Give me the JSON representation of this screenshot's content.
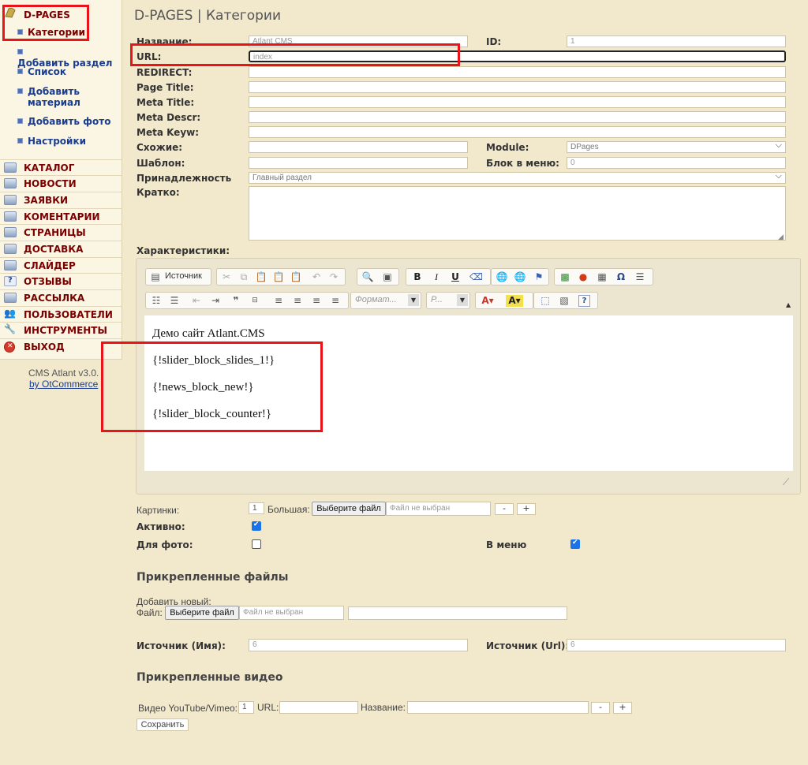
{
  "sidebar": {
    "header": "D-PAGES",
    "sub_items": [
      "Категории",
      "Добавить раздел",
      "Список",
      "Добавить материал",
      "Добавить фото",
      "Настройки"
    ],
    "main_items": [
      "КАТАЛОГ",
      "НОВОСТИ",
      "ЗАЯВКИ",
      "КОМЕНТАРИИ",
      "СТРАНИЦЫ",
      "ДОСТАВКА",
      "СЛАЙДЕР",
      "ОТЗЫВЫ",
      "РАССЫЛКА",
      "ПОЛЬЗОВАТЕЛИ",
      "ИНСТРУМЕНТЫ",
      "ВЫХОД"
    ],
    "footer_version": "CMS Atlant v3.0.",
    "footer_link": "by OtCommerce"
  },
  "page_title": "D-PAGES | Категории",
  "form": {
    "name_label": "Название:",
    "name_value": "Atlant CMS",
    "id_label": "ID:",
    "id_value": "1",
    "url_label": "URL:",
    "url_value": "index",
    "redirect_label": "REDIRECT:",
    "page_title_label": "Page Title:",
    "meta_title_label": "Meta Title:",
    "meta_descr_label": "Meta Descr:",
    "meta_keyw_label": "Meta Keyw:",
    "similar_label": "Схожие:",
    "module_label": "Module:",
    "module_value": "DPages",
    "template_label": "Шаблон:",
    "menu_block_label": "Блок в меню:",
    "menu_block_value": "0",
    "belongs_label": "Принадлежность",
    "belongs_value": "Главный раздел",
    "brief_label": "Кратко:",
    "features_label": "Характеристики:"
  },
  "editor": {
    "source_label": "Источник",
    "format_placeholder": "Формат...",
    "size_placeholder": "Р...",
    "lines": [
      "Демо сайт Atlant.CMS",
      "{!slider_block_slides_1!}",
      "{!news_block_new!}",
      "{!slider_block_counter!}"
    ]
  },
  "images": {
    "label": "Картинки:",
    "count": "1",
    "big_label": "Большая:",
    "choose_file": "Выберите файл",
    "no_file": "Файл не выбран",
    "minus": "-",
    "plus": "+"
  },
  "flags": {
    "active_label": "Активно:",
    "active": true,
    "for_photo_label": "Для фото:",
    "for_photo": false,
    "in_menu_label": "В меню",
    "in_menu": true
  },
  "attached_files": {
    "title": "Прикрепленные файлы",
    "add_new": "Добавить новый:",
    "file_label": "Файл:",
    "choose_file": "Выберите файл",
    "no_file": "Файл не выбран"
  },
  "source": {
    "name_label": "Источник (Имя):",
    "name_value": "6",
    "url_label": "Источник (Url):",
    "url_value": "6"
  },
  "attached_videos": {
    "title": "Прикрепленные видео",
    "video_label": "Видео YouTube/Vimeo:",
    "video_count": "1",
    "url_label": "URL:",
    "title_label": "Название:",
    "minus": "-",
    "plus": "+"
  },
  "save_label": "Сохранить"
}
